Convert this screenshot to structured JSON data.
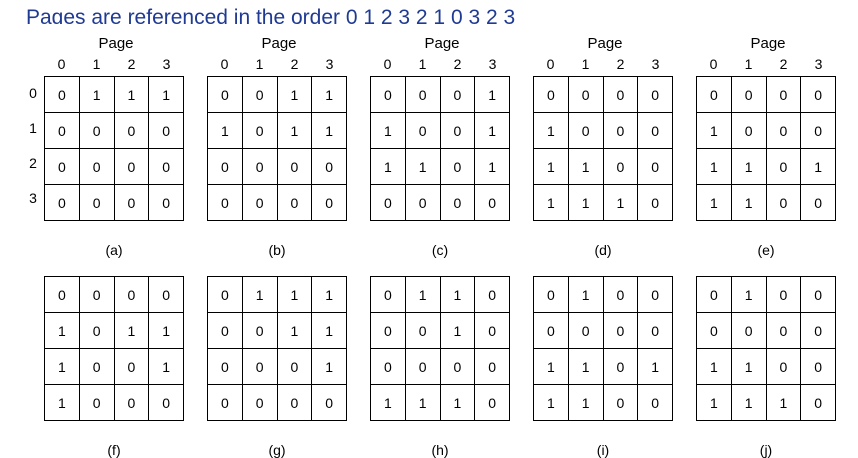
{
  "title": "Pages are referenced in the order 0 1 2 3 2 1 0 3 2 3",
  "page_header": "Page",
  "column_labels": [
    "0",
    "1",
    "2",
    "3"
  ],
  "row_labels": [
    "0",
    "1",
    "2",
    "3"
  ],
  "matrices": [
    {
      "label": "(a)",
      "rows": [
        [
          "0",
          "1",
          "1",
          "1"
        ],
        [
          "0",
          "0",
          "0",
          "0"
        ],
        [
          "0",
          "0",
          "0",
          "0"
        ],
        [
          "0",
          "0",
          "0",
          "0"
        ]
      ]
    },
    {
      "label": "(b)",
      "rows": [
        [
          "0",
          "0",
          "1",
          "1"
        ],
        [
          "1",
          "0",
          "1",
          "1"
        ],
        [
          "0",
          "0",
          "0",
          "0"
        ],
        [
          "0",
          "0",
          "0",
          "0"
        ]
      ]
    },
    {
      "label": "(c)",
      "rows": [
        [
          "0",
          "0",
          "0",
          "1"
        ],
        [
          "1",
          "0",
          "0",
          "1"
        ],
        [
          "1",
          "1",
          "0",
          "1"
        ],
        [
          "0",
          "0",
          "0",
          "0"
        ]
      ]
    },
    {
      "label": "(d)",
      "rows": [
        [
          "0",
          "0",
          "0",
          "0"
        ],
        [
          "1",
          "0",
          "0",
          "0"
        ],
        [
          "1",
          "1",
          "0",
          "0"
        ],
        [
          "1",
          "1",
          "1",
          "0"
        ]
      ]
    },
    {
      "label": "(e)",
      "rows": [
        [
          "0",
          "0",
          "0",
          "0"
        ],
        [
          "1",
          "0",
          "0",
          "0"
        ],
        [
          "1",
          "1",
          "0",
          "1"
        ],
        [
          "1",
          "1",
          "0",
          "0"
        ]
      ]
    },
    {
      "label": "(f)",
      "rows": [
        [
          "0",
          "0",
          "0",
          "0"
        ],
        [
          "1",
          "0",
          "1",
          "1"
        ],
        [
          "1",
          "0",
          "0",
          "1"
        ],
        [
          "1",
          "0",
          "0",
          "0"
        ]
      ]
    },
    {
      "label": "(g)",
      "rows": [
        [
          "0",
          "1",
          "1",
          "1"
        ],
        [
          "0",
          "0",
          "1",
          "1"
        ],
        [
          "0",
          "0",
          "0",
          "1"
        ],
        [
          "0",
          "0",
          "0",
          "0"
        ]
      ]
    },
    {
      "label": "(h)",
      "rows": [
        [
          "0",
          "1",
          "1",
          "0"
        ],
        [
          "0",
          "0",
          "1",
          "0"
        ],
        [
          "0",
          "0",
          "0",
          "0"
        ],
        [
          "1",
          "1",
          "1",
          "0"
        ]
      ]
    },
    {
      "label": "(i)",
      "rows": [
        [
          "0",
          "1",
          "0",
          "0"
        ],
        [
          "0",
          "0",
          "0",
          "0"
        ],
        [
          "1",
          "1",
          "0",
          "1"
        ],
        [
          "1",
          "1",
          "0",
          "0"
        ]
      ]
    },
    {
      "label": "(j)",
      "rows": [
        [
          "0",
          "1",
          "0",
          "0"
        ],
        [
          "0",
          "0",
          "0",
          "0"
        ],
        [
          "1",
          "1",
          "0",
          "0"
        ],
        [
          "1",
          "1",
          "1",
          "0"
        ]
      ]
    }
  ],
  "colors": {
    "title_text": "#1f3a93",
    "grid_line": "#000000",
    "text": "#000000"
  }
}
